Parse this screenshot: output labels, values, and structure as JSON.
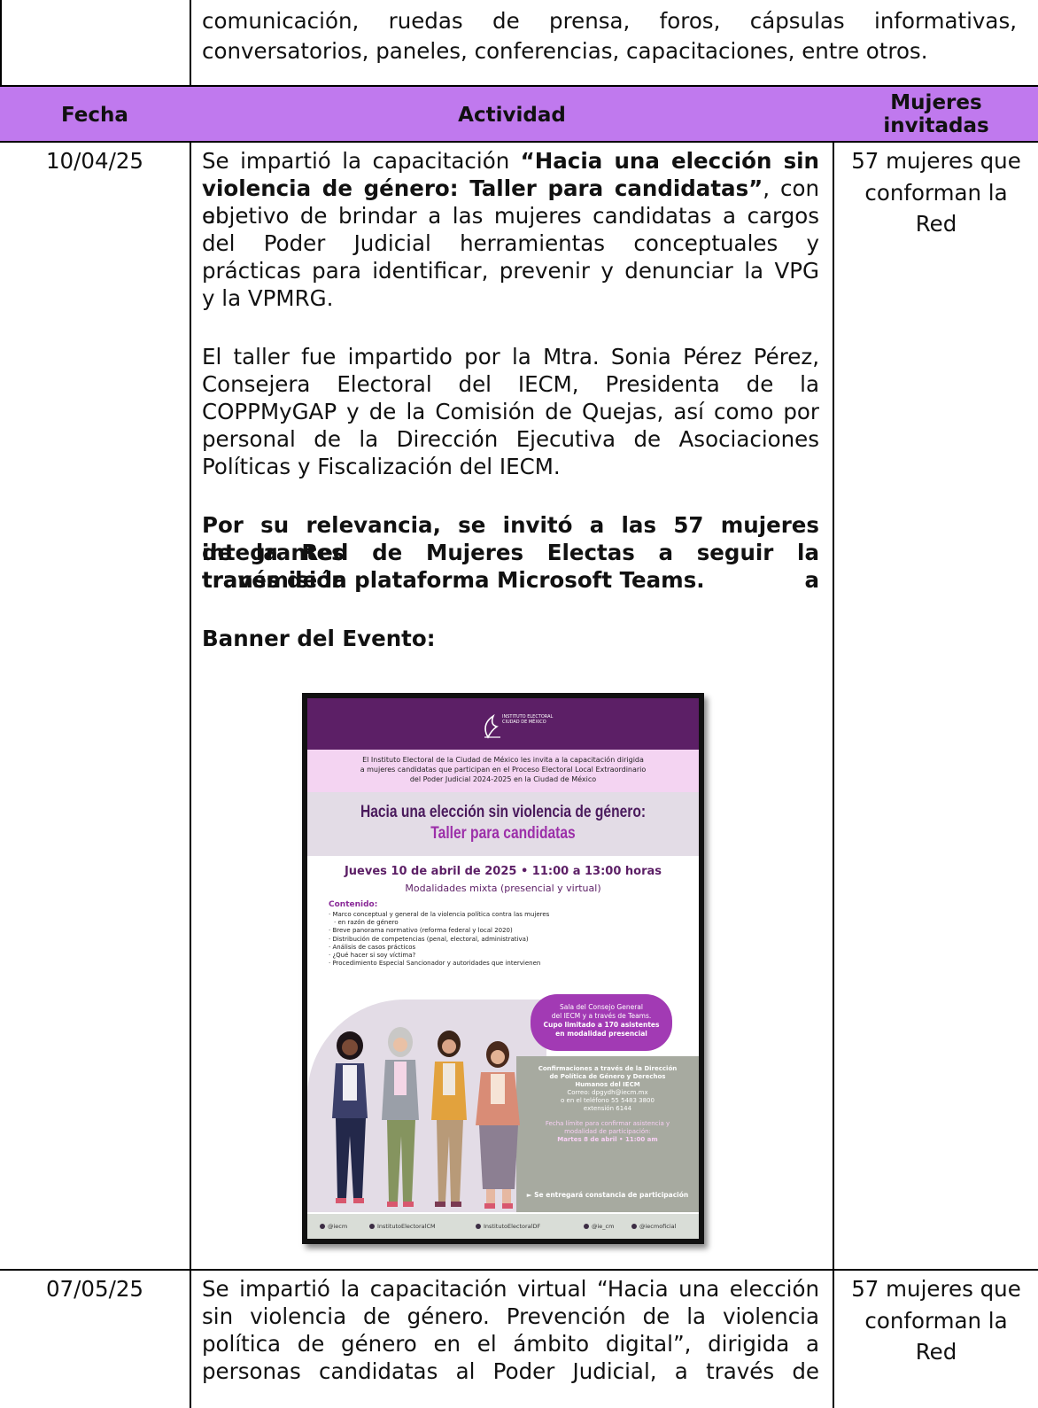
{
  "top_text": {
    "line1": "comunicación, ruedas de prensa, foros, cápsulas informativas,",
    "line2": "conversatorios, paneles, conferencias, capacitaciones, entre otros."
  },
  "headers": {
    "fecha": "Fecha",
    "actividad": "Actividad",
    "mujeres_line1": "Mujeres",
    "mujeres_line2": "invitadas"
  },
  "rows": [
    {
      "fecha": "10/04/25",
      "p1": {
        "l1_pre": "Se impartió la capacitación ",
        "l1_bold": "“Hacia una elección sin",
        "l2_bold": "violencia de género: Taller para candidatas”",
        "l2_post": ", con el",
        "l3": "objetivo de brindar a las mujeres candidatas a cargos",
        "l4": "del Poder Judicial herramientas conceptuales y",
        "l5": "prácticas para identificar, prevenir y denunciar la VPG",
        "l6": "y la VPMRG."
      },
      "p2": {
        "l1": "El taller fue impartido por la Mtra. Sonia Pérez Pérez,",
        "l2": "Consejera Electoral del IECM, Presidenta de la",
        "l3": "COPPMyGAP y de la Comisión de Quejas, así como por",
        "l4": "personal de la Dirección Ejecutiva de Asociaciones",
        "l5": "Políticas y Fiscalización del IECM."
      },
      "p3": {
        "l1": "Por su relevancia, se invitó a las 57 mujeres integrantes",
        "l2": "de la Red de Mujeres Electas a seguir la transmisión a",
        "l3": "través de la plataforma Microsoft Teams."
      },
      "banner_label": "Banner del Evento:",
      "mujeres": {
        "l1": "57 mujeres que",
        "l2": "conforman la",
        "l3": "Red"
      }
    },
    {
      "fecha": "07/05/25",
      "p1": {
        "l1": "Se impartió la capacitación virtual “Hacia una elección",
        "l2": "sin violencia de género. Prevención de la violencia",
        "l3": "política de género en el ámbito digital”, dirigida a",
        "l4": "personas candidatas al Poder Judicial, a través de"
      },
      "mujeres": {
        "l1": "57 mujeres que",
        "l2": "conforman la",
        "l3": "Red"
      }
    }
  ],
  "banner": {
    "logo_text_1": "INSTITUTO ELECTORAL",
    "logo_text_2": "CIUDAD DE MÉXICO",
    "intro_1": "El Instituto Electoral de la Ciudad de México les invita a la capacitación dirigida",
    "intro_2": "a mujeres candidatas que participan en el Proceso Electoral Local Extraordinario",
    "intro_3": "del Poder Judicial 2024-2025 en la Ciudad de México",
    "title_1": "Hacia una elección sin violencia de género:",
    "title_2": "Taller para candidatas",
    "date": "Jueves 10 de abril de 2025 • 11:00 a 13:00 horas",
    "modality": "Modalidades mixta (presencial y virtual)",
    "contenido": "Contenido:",
    "items": [
      "Marco conceptual y general de la violencia política contra las mujeres",
      "en razón de género",
      "Breve panorama normativo (reforma federal y local 2020)",
      "Distribución de competencias (penal, electoral, administrativa)",
      "Análisis de casos prácticos",
      "¿Qué hacer si soy víctima?",
      "Procedimiento Especial Sancionador y autoridades que intervienen"
    ],
    "sala_1": "Sala del Consejo General",
    "sala_2": "del IECM y a través de Teams.",
    "sala_3": "Cupo limitado a 170 asistentes",
    "sala_4": "en modalidad presencial",
    "conf_1": "Confirmaciones a través de la Dirección",
    "conf_2": "de Política de Género y Derechos",
    "conf_3": "Humanos del IECM",
    "conf_4": "Correo: dpgydh@iecm.mx",
    "conf_5": "o en el teléfono 55 5483 3800",
    "conf_6": "extensión 6144",
    "limit_1": "Fecha límite para confirmar asistencia y",
    "limit_2": "modalidad de participación:",
    "limit_3": "Martes 8 de abril • 11:00 am",
    "constancia": "► Se entregará constancia de participación",
    "social": [
      "@iecm",
      "InstitutoElectoralCM",
      "InstitutoElectoralDF",
      "@ie_cm",
      "@iecmoficial"
    ]
  },
  "colors": {
    "header_bg": "#c079ee",
    "banner_purple": "#5c1f66",
    "banner_magenta": "#a23ab4"
  }
}
